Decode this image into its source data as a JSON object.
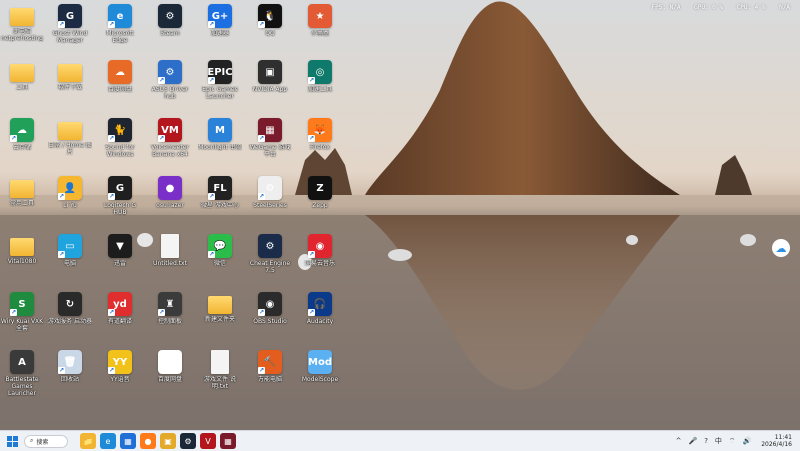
{
  "monitor": {
    "fps": "FPS: N/A",
    "gpu": "GPU: 0 %",
    "cpu": "CPU: 4 %",
    "temp": "N/A"
  },
  "icons": [
    {
      "label": "此电脑\nnetprehosting",
      "name": "this-pc",
      "kind": "folder",
      "color": "#f2b533",
      "glyph": ""
    },
    {
      "label": "Ghost Wind Manager",
      "name": "ghost-wind-manager",
      "kind": "app",
      "color": "#1d2a44",
      "glyph": "G"
    },
    {
      "label": "Microsoft Edge",
      "name": "microsoft-edge",
      "kind": "app",
      "color": "#1f8ad8",
      "glyph": "e"
    },
    {
      "label": "Steam",
      "name": "steam",
      "kind": "app",
      "color": "#1b2838",
      "glyph": "⚙"
    },
    {
      "label": "加速器",
      "name": "accelerator-g",
      "kind": "app",
      "color": "#1c6fe0",
      "glyph": "G+"
    },
    {
      "label": "QQ",
      "name": "qq",
      "kind": "app",
      "color": "#111111",
      "glyph": "🐧"
    },
    {
      "label": "小黑盒",
      "name": "xiaoheihe",
      "kind": "app",
      "color": "#e25b34",
      "glyph": "★"
    },
    {
      "label": "工具",
      "name": "tools-folder",
      "kind": "folder",
      "color": "#f2b533",
      "glyph": ""
    },
    {
      "label": "软件下载",
      "name": "downloads-folder",
      "kind": "folder",
      "color": "#f2b533",
      "glyph": ""
    },
    {
      "label": "百度网盘",
      "name": "baidu-netdisk",
      "kind": "app",
      "color": "#e86a27",
      "glyph": "☁"
    },
    {
      "label": "ASUS Driver hub",
      "name": "asus-driver-hub",
      "kind": "app",
      "color": "#2d6ec9",
      "glyph": "⚙"
    },
    {
      "label": "Epic Games Launcher",
      "name": "epic-games",
      "kind": "app",
      "color": "#222222",
      "glyph": "EPIC"
    },
    {
      "label": "NVIDIA App",
      "name": "nvidia-app",
      "kind": "app",
      "color": "#2f2f2f",
      "glyph": "▣"
    },
    {
      "label": "加速工具",
      "name": "speed-tool",
      "kind": "app",
      "color": "#0f7a6b",
      "glyph": "◎"
    },
    {
      "label": "云存储",
      "name": "cloud-storage",
      "kind": "app",
      "color": "#21a05a",
      "glyph": "☁"
    },
    {
      "label": "日常 / Home 图片",
      "name": "pictures-folder",
      "kind": "folder",
      "color": "#f2b533",
      "glyph": ""
    },
    {
      "label": "Sound for Windows",
      "name": "sound-for-windows",
      "kind": "app",
      "color": "#1e2430",
      "glyph": "🐈"
    },
    {
      "label": "Voicemeeter Banana x64",
      "name": "voicemeeter",
      "kind": "app",
      "color": "#b3161c",
      "glyph": "VM"
    },
    {
      "label": "Moonlight 串流",
      "name": "moonlight",
      "kind": "app",
      "color": "#2a83d8",
      "glyph": "M"
    },
    {
      "label": "WeGame 游戏平台",
      "name": "wegame",
      "kind": "app",
      "color": "#7a1b2c",
      "glyph": "▦"
    },
    {
      "label": "Firefox",
      "name": "firefox",
      "kind": "app",
      "color": "#ff7a1a",
      "glyph": "🦊"
    },
    {
      "label": "常用工具",
      "name": "common-tools-folder",
      "kind": "folder",
      "color": "#f2b533",
      "glyph": ""
    },
    {
      "label": "Li Yu",
      "name": "li-yu",
      "kind": "app",
      "color": "#f5b730",
      "glyph": "👤"
    },
    {
      "label": "Logitech G HUB",
      "name": "logitech-ghub",
      "kind": "app",
      "color": "#1f1f1f",
      "glyph": "G"
    },
    {
      "label": "osu!lazer",
      "name": "osu-lazer",
      "kind": "app",
      "color": "#7a2fc9",
      "glyph": "●"
    },
    {
      "label": "微星 游戏中心",
      "name": "msi-center",
      "kind": "app",
      "color": "#222222",
      "glyph": "FL"
    },
    {
      "label": "SteelSeries",
      "name": "steelseries",
      "kind": "app",
      "color": "#eeeeee",
      "glyph": "⚙"
    },
    {
      "label": "Zepp",
      "name": "zepp",
      "kind": "app",
      "color": "#111111",
      "glyph": "Z"
    },
    {
      "label": "Vital1080",
      "name": "vital-folder",
      "kind": "folder",
      "color": "#f2b533",
      "glyph": ""
    },
    {
      "label": "电脑",
      "name": "computer",
      "kind": "app",
      "color": "#1fa4de",
      "glyph": "▭"
    },
    {
      "label": "迅雷",
      "name": "thunder",
      "kind": "app",
      "color": "#1c1c1c",
      "glyph": "▼"
    },
    {
      "label": "Untitled.txt",
      "name": "untitled-file",
      "kind": "file",
      "color": "#f4f4f4",
      "glyph": ""
    },
    {
      "label": "微信",
      "name": "wechat",
      "kind": "app",
      "color": "#2bbd4a",
      "glyph": "💬"
    },
    {
      "label": "Cheat Engine 7.5",
      "name": "cheat-engine",
      "kind": "app",
      "color": "#1a2c4a",
      "glyph": "⚙"
    },
    {
      "label": "网易云音乐",
      "name": "netease-music",
      "kind": "app",
      "color": "#e1252e",
      "glyph": "◉"
    },
    {
      "label": "Wiry Kuai VXK全套",
      "name": "wiry-kuai",
      "kind": "app",
      "color": "#1f8b3f",
      "glyph": "S"
    },
    {
      "label": "游戏服务 启动器",
      "name": "game-service",
      "kind": "app",
      "color": "#2a2a2a",
      "glyph": "↻"
    },
    {
      "label": "有道翻译",
      "name": "youdao",
      "kind": "app",
      "color": "#e02e2e",
      "glyph": "yd"
    },
    {
      "label": "控制面板",
      "name": "control-panel",
      "kind": "app",
      "color": "#3b3b3b",
      "glyph": "♜"
    },
    {
      "label": "新建文件夹",
      "name": "new-folder",
      "kind": "folder",
      "color": "#f2b533",
      "glyph": ""
    },
    {
      "label": "OBS Studio",
      "name": "obs-studio",
      "kind": "app",
      "color": "#2b2b2b",
      "glyph": "◉"
    },
    {
      "label": "Audacity",
      "name": "audacity",
      "kind": "app",
      "color": "#0b3a8a",
      "glyph": "🎧"
    },
    {
      "label": "Battlestate Games Launcher",
      "name": "battlestate-launcher",
      "kind": "app",
      "color": "#3a3a3a",
      "glyph": "A"
    },
    {
      "label": "回收站",
      "name": "recycle-bin",
      "kind": "app",
      "color": "#c9d7e6",
      "glyph": "🗑"
    },
    {
      "label": "YY语音",
      "name": "yy",
      "kind": "app",
      "color": "#f3c21a",
      "glyph": "YY"
    },
    {
      "label": "百度网盘",
      "name": "baidu-netdisk-2",
      "kind": "app",
      "color": "#ffffff",
      "glyph": "☁"
    },
    {
      "label": "游戏文件 说明.txt",
      "name": "game-notes-file",
      "kind": "file",
      "color": "#f4f4f4",
      "glyph": ""
    },
    {
      "label": "万能电脑",
      "name": "universal-pc",
      "kind": "app",
      "color": "#e35d1f",
      "glyph": "🔨"
    },
    {
      "label": "ModelScope",
      "name": "modelscope",
      "kind": "app",
      "color": "#5ab0f0",
      "glyph": "Mod"
    }
  ],
  "taskbar": {
    "search_label": "搜索",
    "apps": [
      {
        "name": "file-explorer",
        "glyph": "📁",
        "color": "#f2b533"
      },
      {
        "name": "edge",
        "glyph": "e",
        "color": "#1f8ad8"
      },
      {
        "name": "store",
        "glyph": "▦",
        "color": "#1f6fd6"
      },
      {
        "name": "firefox",
        "glyph": "●",
        "color": "#ff7a1a"
      },
      {
        "name": "folder",
        "glyph": "▣",
        "color": "#e2a92a"
      },
      {
        "name": "steam",
        "glyph": "⚙",
        "color": "#1b2838"
      },
      {
        "name": "voicemeeter",
        "glyph": "V",
        "color": "#b3161c"
      },
      {
        "name": "wegame",
        "glyph": "▦",
        "color": "#7a1b2c"
      }
    ],
    "tray_ime": "中",
    "time": "11:41",
    "date": "2026/4/16"
  }
}
